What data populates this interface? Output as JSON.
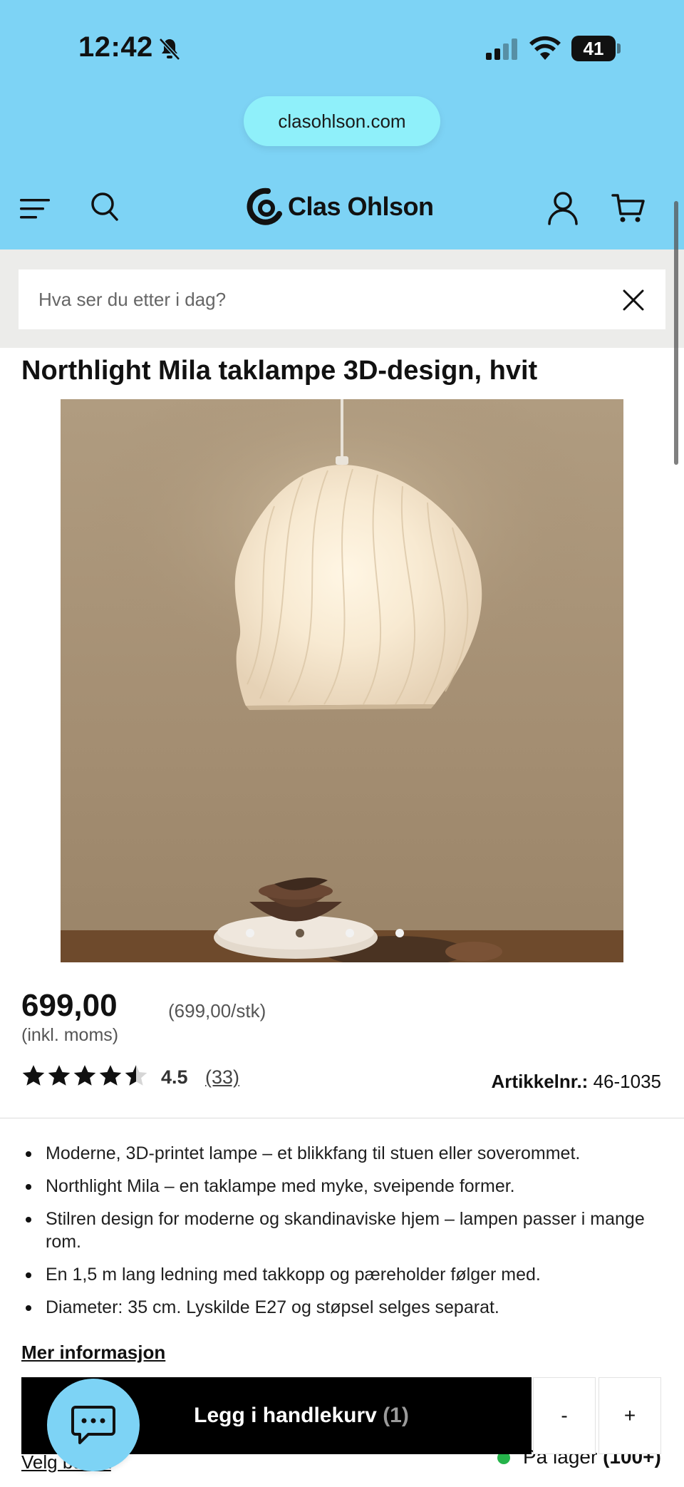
{
  "status_bar": {
    "time": "12:42",
    "battery": "41",
    "icons": [
      "bell-muted-icon",
      "cellular-signal-icon",
      "wifi-icon",
      "battery-icon"
    ]
  },
  "browser": {
    "url": "clasohlson.com"
  },
  "header": {
    "brand": "Clas Ohlson",
    "icons": [
      "menu-icon",
      "search-icon",
      "clas-ohlson-logo-icon",
      "user-icon",
      "cart-icon"
    ]
  },
  "search": {
    "placeholder": "Hva ser du etter i dag?"
  },
  "product": {
    "title": "Northlight Mila taklampe 3D-design, hvit",
    "price": "699,00",
    "unit_price": "(699,00/stk)",
    "vat_note": "(inkl. moms)",
    "rating": "4.5",
    "rating_fraction": 0.9,
    "review_count": "(33)",
    "sku_label": "Artikkelnr.:",
    "sku": "46-1035",
    "image_dots": 4,
    "features": [
      "Moderne, 3D-printet lampe – et blikkfang til stuen eller soverommet.",
      "Northlight Mila – en taklampe med myke, sveipende former.",
      "Stilren design for moderne og skandinaviske hjem – lampen passer i mange rom.",
      "En 1,5 m lang ledning med takkopp og pæreholder følger med.",
      "Diameter: 35 cm. Lyskilde E27 og støpsel selges separat."
    ],
    "more_info": "Mer informasjon"
  },
  "purchase": {
    "add_to_cart": "Legg i handlekurv",
    "cart_qty": "(1)",
    "minus": "-",
    "plus": "+",
    "stock_text": "På lager",
    "stock_count": "(100+)",
    "select_link": "Velg butikk"
  },
  "colors": {
    "header_bg": "#7dd3f5",
    "url_pill_bg": "#8ff0fa",
    "search_band_bg": "#ececea",
    "button_bg": "#000000",
    "stock_green": "#25b34a"
  }
}
